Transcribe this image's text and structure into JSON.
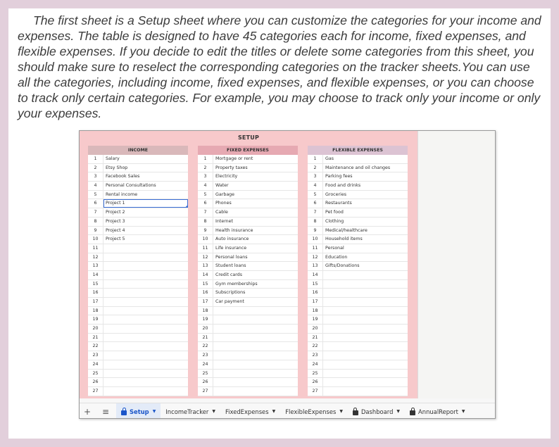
{
  "intro_text": "The first sheet is a Setup sheet where you can customize the categories for your income and expenses. The table is designed to have 45 categories each for income, fixed expenses, and flexible expenses. If you decide to edit the titles or delete some categories from this sheet, you should make sure to reselect the corresponding categories on the tracker sheets.You can use all the categories, including income, fixed expenses, and flexible expenses, or you can choose to track only certain categories. For example, you may choose to track only your income or only your expenses.",
  "sheet": {
    "title": "SETUP",
    "columns": [
      {
        "header": "INCOME",
        "items": [
          "Salary",
          "Etsy Shop",
          "Facebook Sales",
          "Personal Consultations",
          "Rental income",
          "Project 1",
          "Project 2",
          "Project 3",
          "Project 4",
          "Project 5"
        ]
      },
      {
        "header": "FIXED EXPENSES",
        "items": [
          "Mortgage or rent",
          "Property taxes",
          "Electricity",
          "Water",
          "Garbage",
          "Phones",
          "Cable",
          "Internet",
          "Health insurance",
          "Auto insurance",
          "Life insurance",
          "Personal loans",
          "Student loans",
          "Credit cards",
          "Gym memberships",
          "Subscriptions",
          "Car payment"
        ]
      },
      {
        "header": "FLEXIBLE EXPENSES",
        "items": [
          "Gas",
          "Maintenance and oil changes",
          "Parking fees",
          "Food and drinks",
          "Groceries",
          "Restaurants",
          "Pet food",
          "Clothing",
          "Medical/healthcare",
          "Household items",
          "Personal",
          "Education",
          "Gifts/Donations"
        ]
      }
    ],
    "row_numbers": [
      "1",
      "2",
      "3",
      "4",
      "5",
      "6",
      "7",
      "8",
      "9",
      "10",
      "11",
      "12",
      "13",
      "14",
      "15",
      "16",
      "17",
      "18",
      "19",
      "20",
      "21",
      "22",
      "23",
      "24",
      "25",
      "26",
      "27"
    ]
  },
  "tabbar": {
    "add_icon": "+",
    "menu_icon": "≡",
    "tabs": [
      {
        "label": "Setup",
        "locked": true,
        "active": true
      },
      {
        "label": "IncomeTracker",
        "locked": false,
        "active": false
      },
      {
        "label": "FixedExpenses",
        "locked": false,
        "active": false
      },
      {
        "label": "FlexibleExpenses",
        "locked": false,
        "active": false
      },
      {
        "label": "Dashboard",
        "locked": true,
        "active": false
      },
      {
        "label": "AnnualReport",
        "locked": true,
        "active": false
      }
    ]
  }
}
